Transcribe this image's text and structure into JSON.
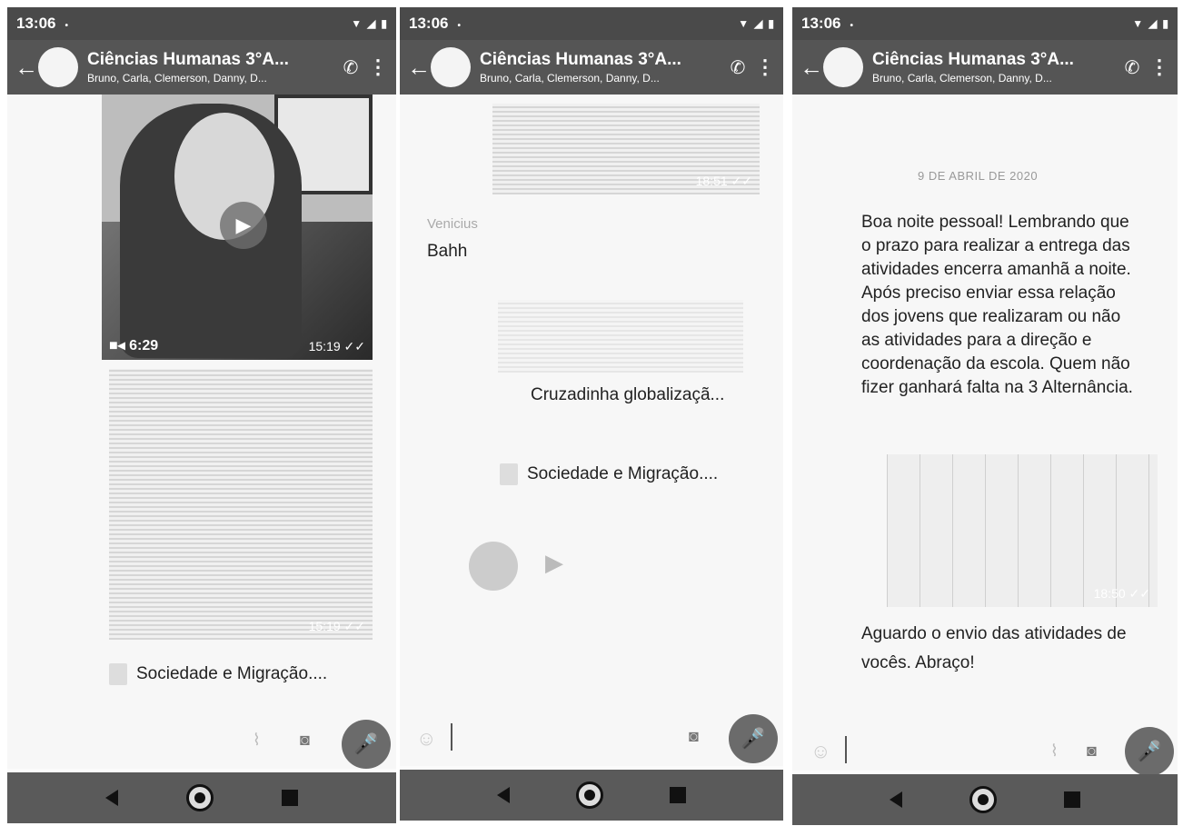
{
  "status_time": "13:06",
  "status_dot": "•",
  "chat": {
    "title": "Ciências Humanas 3°A...",
    "subtitle": "Bruno, Carla, Clemerson, Danny, D..."
  },
  "screen1": {
    "video_duration": "6:29",
    "video_time": "15:19 ✓✓",
    "doc_time": "15:19 ✓✓",
    "file_name": "Sociedade e Migração...."
  },
  "screen2": {
    "image_time": "18:51 ✓✓",
    "sender": "Venicius",
    "message": "Bahh",
    "doc_caption": "Cruzadinha globalizaçã...",
    "file_name": "Sociedade e Migração...."
  },
  "screen3": {
    "date": "9 DE ABRIL DE 2020",
    "message1": "Boa noite pessoal! Lembrando que o prazo para realizar a entrega das atividades encerra amanhã a noite. Após preciso enviar essa relação dos jovens que realizaram ou não as atividades para a direção e coordenação da escola. Quem não fizer ganhará falta na 3 Alternância.",
    "image_time": "18:50 ✓✓",
    "message2": "Aguardo o envio das atividades de vocês. Abraço!"
  },
  "icons": [
    "back-arrow-icon",
    "add-call-icon",
    "more-vert-icon",
    "mic-icon",
    "camera-icon",
    "play-icon",
    "video-camera-icon",
    "document-icon",
    "nav-back-icon",
    "nav-home-icon",
    "nav-recents-icon"
  ]
}
